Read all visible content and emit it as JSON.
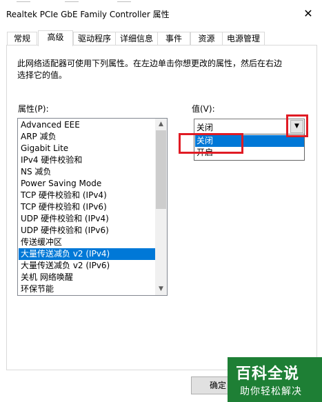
{
  "window": {
    "title": "Realtek PCIe GbE Family Controller 属性",
    "close_glyph": "✕"
  },
  "tabs": [
    {
      "label": "常规"
    },
    {
      "label": "高级"
    },
    {
      "label": "驱动程序"
    },
    {
      "label": "详细信息"
    },
    {
      "label": "事件"
    },
    {
      "label": "资源"
    },
    {
      "label": "电源管理"
    }
  ],
  "active_tab": "高级",
  "description": "此网络适配器可使用下列属性。在左边单击你想更改的属性，然后在右边选择它的值。",
  "property_label": "属性(P):",
  "value_label": "值(V):",
  "properties": [
    "Advanced EEE",
    "ARP 减负",
    "Gigabit Lite",
    "IPv4 硬件校验和",
    "NS 减负",
    "Power Saving Mode",
    "TCP 硬件校验和 (IPv4)",
    "TCP 硬件校验和 (IPv6)",
    "UDP 硬件校验和 (IPv4)",
    "UDP 硬件校验和 (IPv6)",
    "传送缓冲区",
    "大量传送减负 v2 (IPv4)",
    "大量传送减负 v2 (IPv6)",
    "关机 网络唤醒",
    "环保节能"
  ],
  "selected_property": "大量传送减负 v2 (IPv4)",
  "value_combo": {
    "current": "关闭",
    "options": [
      "关闭",
      "开启"
    ],
    "highlighted": "关闭"
  },
  "icons": {
    "close": "close-icon",
    "scroll_up": "scroll-up-icon",
    "scroll_down": "scroll-down-icon",
    "dropdown": "chevron-down-icon"
  },
  "ok_label": "确定",
  "watermark": {
    "title": "百科全说",
    "subtitle": "助你轻松解决"
  },
  "colors": {
    "selection": "#0078d7",
    "highlight_box": "#e01b24",
    "watermark_bg": "#1e7f35"
  }
}
